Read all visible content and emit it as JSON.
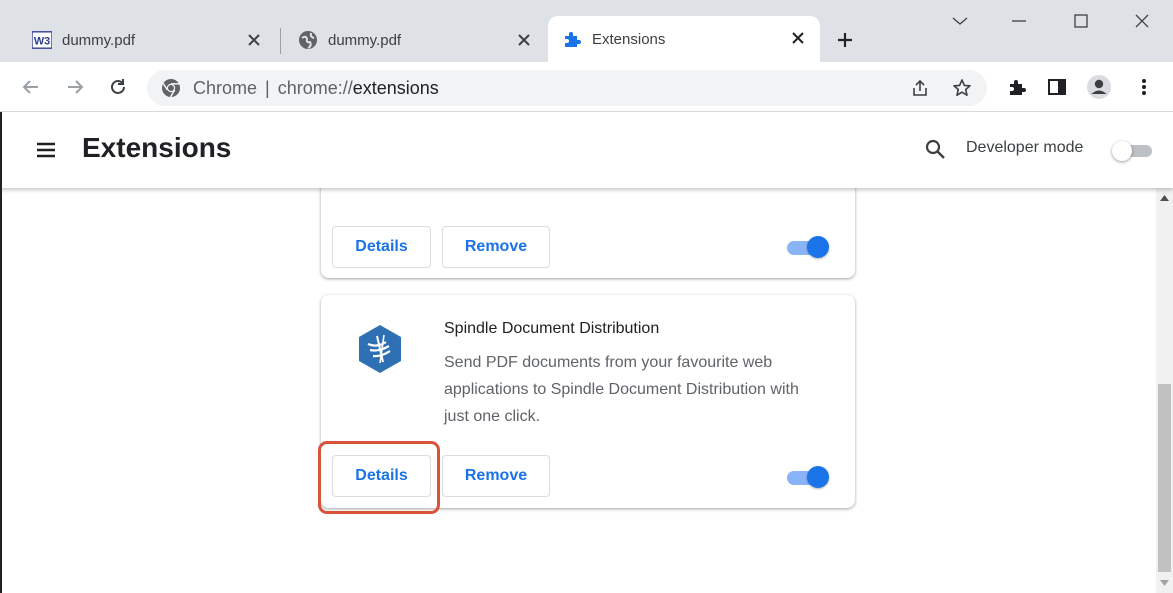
{
  "tabs": [
    {
      "title": "dummy.pdf",
      "favicon": "w3schools-icon",
      "active": false
    },
    {
      "title": "dummy.pdf",
      "favicon": "globe-icon",
      "active": false
    },
    {
      "title": "Extensions",
      "favicon": "puzzle-icon",
      "active": true
    }
  ],
  "window_controls": [
    "chevron-down-icon",
    "minimize-icon",
    "maximize-icon",
    "close-icon"
  ],
  "omnibox": {
    "site_label": "Chrome",
    "separator": "|",
    "scheme": "chrome://",
    "host": "extensions"
  },
  "toolbar_icons": [
    "share-icon",
    "star-icon",
    "extensions-icon",
    "side-panel-icon",
    "profile-icon",
    "kebab-menu-icon"
  ],
  "header": {
    "title": "Extensions",
    "developer_mode_label": "Developer mode",
    "developer_mode_enabled": false
  },
  "extensions": [
    {
      "name": "",
      "details_label": "Details",
      "remove_label": "Remove",
      "enabled": true
    },
    {
      "name": "Spindle Document Distribution",
      "description": "Send PDF documents from your favourite web applications to Spindle Document Distribution with just one click.",
      "details_label": "Details",
      "remove_label": "Remove",
      "enabled": true,
      "icon": "spindle-logo-icon"
    }
  ],
  "colors": {
    "accent": "#1a73e8",
    "highlight": "#d9533b",
    "tabstrip": "#dee1e6"
  }
}
